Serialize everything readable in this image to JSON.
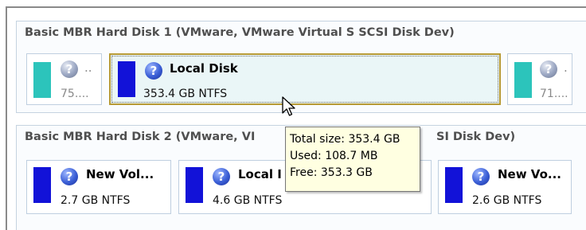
{
  "disk1": {
    "title": "Basic MBR Hard Disk 1 (VMware, VMware Virtual S SCSI Disk Dev)",
    "partitions": [
      {
        "name": "..",
        "size": "75....",
        "bar_color": "#2cc4bb",
        "icon": "question-icon"
      },
      {
        "name": "Local Disk",
        "size": "353.4 GB NTFS",
        "bar_color": "#1212d8",
        "icon": "question-icon",
        "selected": true
      },
      {
        "name": ".",
        "size": "71....",
        "bar_color": "#2cc4bb",
        "icon": "question-icon"
      }
    ]
  },
  "disk2": {
    "title": "Basic MBR Hard Disk 2 (VMware, VI",
    "title_tail": "SI Disk Dev)",
    "partitions": [
      {
        "name": "New Vol...",
        "size": "2.7 GB NTFS",
        "bar_color": "#1212d8",
        "icon": "question-icon"
      },
      {
        "name": "Local I",
        "size": "4.6 GB NTFS",
        "bar_color": "#1212d8",
        "icon": "question-icon"
      },
      {
        "name": "New Vo...",
        "size": "2.6 GB NTFS",
        "bar_color": "#1212d8",
        "icon": "question-icon"
      }
    ]
  },
  "tooltip": {
    "total": "Total size: 353.4 GB",
    "used": "Used: 108.7 MB",
    "free": "Free: 353.3 GB"
  },
  "icons": {
    "help": "?"
  }
}
